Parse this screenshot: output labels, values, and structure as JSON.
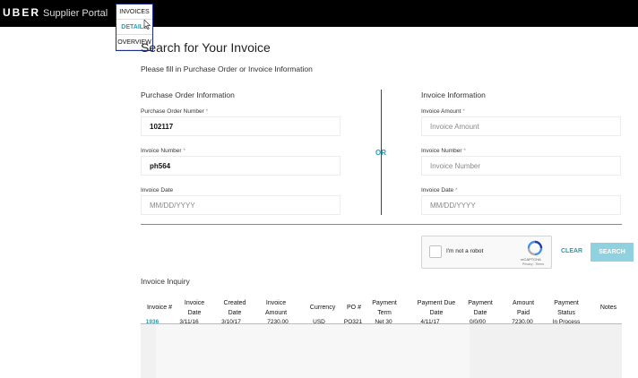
{
  "header": {
    "brand": "UBER",
    "portal": "Supplier Portal",
    "menu": [
      {
        "label": "INVOICES"
      },
      {
        "label": "DETAILS"
      },
      {
        "label": "OVERVIEW"
      }
    ]
  },
  "page": {
    "title": "Search for Your Invoice",
    "subtitle": "Please fill in Purchase Order or Invoice Information"
  },
  "purchase_order": {
    "section_title": "Purchase Order Information",
    "po_number": {
      "label": "Purchase Order Number",
      "required": "*",
      "value": "102117"
    },
    "invoice_number": {
      "label": "Invoice Number",
      "required": "*",
      "value": "ph564"
    },
    "invoice_date": {
      "label": "Invoice Date",
      "placeholder": "MM/DD/YYYY"
    }
  },
  "or_label": "OR",
  "invoice_info": {
    "section_title": "Invoice Information",
    "invoice_amount": {
      "label": "Invoice Amount",
      "required": "*",
      "placeholder": "Invoice Amount"
    },
    "invoice_number": {
      "label": "Invoice Number",
      "required": "*",
      "placeholder": "Invoice Number"
    },
    "invoice_date": {
      "label": "Invoice Date",
      "required": "*",
      "placeholder": "MM/DD/YYYY"
    }
  },
  "captcha": {
    "label": "I'm not a robot",
    "brand": "reCAPTCHA",
    "terms": "Privacy - Terms"
  },
  "actions": {
    "clear": "CLEAR",
    "search": "SEARCH"
  },
  "inquiry": {
    "title": "Invoice Inquiry",
    "columns": [
      {
        "l1": "Invoice #",
        "l2": ""
      },
      {
        "l1": "Invoice",
        "l2": "Date"
      },
      {
        "l1": "Created",
        "l2": "Date"
      },
      {
        "l1": "Invoice",
        "l2": "Amount"
      },
      {
        "l1": "Currency",
        "l2": ""
      },
      {
        "l1": "PO #",
        "l2": ""
      },
      {
        "l1": "Payment",
        "l2": "Term"
      },
      {
        "l1": "Payment Due",
        "l2": "Date"
      },
      {
        "l1": "Payment",
        "l2": "Date"
      },
      {
        "l1": "Amount",
        "l2": "Paid"
      },
      {
        "l1": "Payment",
        "l2": "Status"
      },
      {
        "l1": "Notes",
        "l2": ""
      }
    ],
    "rows": [
      {
        "invoice_no": "1936",
        "invoice_date": "3/11/16",
        "created_date": "3/10/17",
        "invoice_amount": "7230.00",
        "currency": "USD",
        "po": "PO321",
        "payment_term": "Net 30",
        "payment_due": "4/11/17",
        "payment_date": "0/0/00",
        "amount_paid": "7230.00",
        "payment_status": "In Process",
        "notes": ""
      }
    ]
  },
  "colors": {
    "accent": "#2a9dae",
    "search_button": "#8fd1df",
    "topbar": "#000000"
  }
}
